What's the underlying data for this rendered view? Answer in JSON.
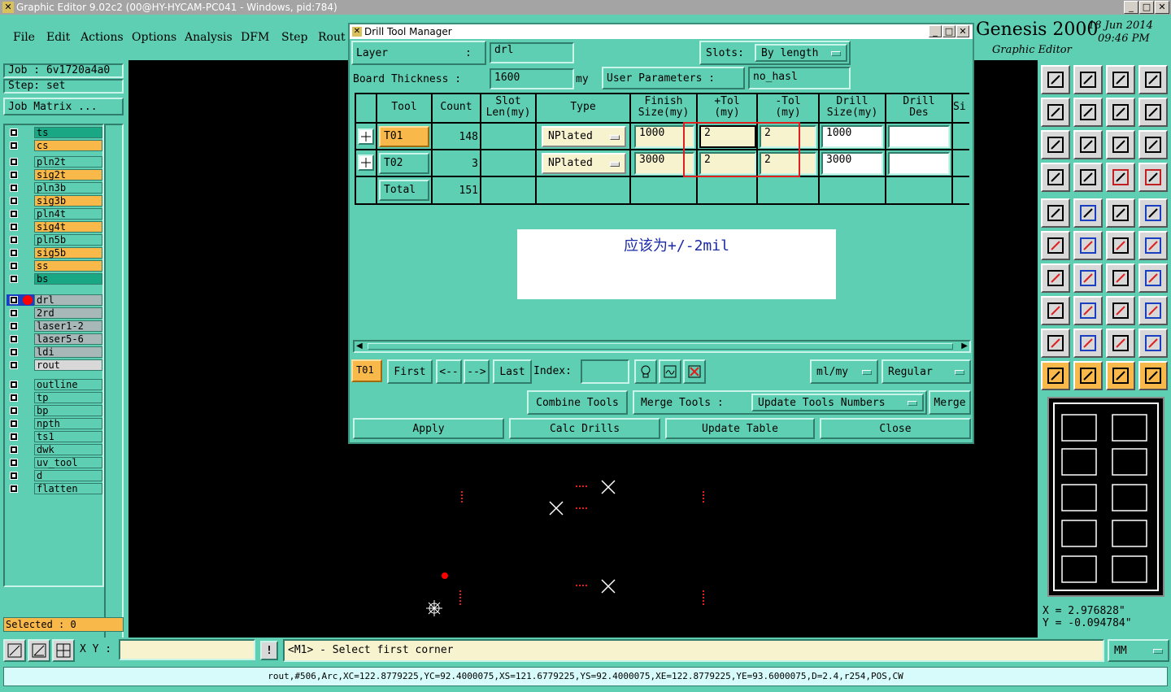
{
  "window": {
    "title": "Graphic Editor 9.02c2 (00@HY-HYCAM-PC041 - Windows, pid:784)"
  },
  "menu": {
    "items": [
      "File",
      "Edit",
      "Actions",
      "Options",
      "Analysis",
      "DFM",
      "Step",
      "Rout"
    ]
  },
  "brand": {
    "name": "Genesis 2000",
    "subtitle": "Graphic Editor",
    "date": "18 Jun 2014",
    "time": "09:46 PM"
  },
  "job": {
    "job_label": "Job : 6v1720a4a0",
    "step_label": "Step: set",
    "matrix_button": "Job Matrix ..."
  },
  "layers": [
    {
      "name": "ts",
      "color": "#1aa884"
    },
    {
      "name": "cs",
      "color": "#f8b84a"
    },
    {
      "name": "pln2t",
      "color": "#5fcfb3"
    },
    {
      "name": "sig2t",
      "color": "#f8b84a"
    },
    {
      "name": "pln3b",
      "color": "#5fcfb3"
    },
    {
      "name": "sig3b",
      "color": "#f8b84a"
    },
    {
      "name": "pln4t",
      "color": "#5fcfb3"
    },
    {
      "name": "sig4t",
      "color": "#f8b84a"
    },
    {
      "name": "pln5b",
      "color": "#5fcfb3"
    },
    {
      "name": "sig5b",
      "color": "#f8b84a"
    },
    {
      "name": "ss",
      "color": "#f8b84a"
    },
    {
      "name": "bs",
      "color": "#1aa884"
    },
    {
      "name": "drl",
      "color": "#a8b8b8"
    },
    {
      "name": "2rd",
      "color": "#a8b8b8"
    },
    {
      "name": "laser1-2",
      "color": "#a8b8b8"
    },
    {
      "name": "laser5-6",
      "color": "#a8b8b8"
    },
    {
      "name": "ldi",
      "color": "#a8b8b8"
    },
    {
      "name": "rout",
      "color": "#d8d8d8"
    },
    {
      "name": "outline",
      "color": "#5fcfb3"
    },
    {
      "name": "tp",
      "color": "#5fcfb3"
    },
    {
      "name": "bp",
      "color": "#5fcfb3"
    },
    {
      "name": "npth",
      "color": "#5fcfb3"
    },
    {
      "name": "ts1",
      "color": "#5fcfb3"
    },
    {
      "name": "dwk",
      "color": "#5fcfb3"
    },
    {
      "name": "uv_tool",
      "color": "#5fcfb3"
    },
    {
      "name": "d",
      "color": "#5fcfb3"
    },
    {
      "name": "flatten",
      "color": "#5fcfb3"
    }
  ],
  "selected": {
    "label": "Selected : 0"
  },
  "dialog": {
    "title": "Drill Tool Manager",
    "layer_label": "Layer",
    "layer_colon": ":",
    "layer_value": "drl",
    "slots_label": "Slots:",
    "slots_value": "By length",
    "board_thickness_label": "Board Thickness :",
    "board_thickness_value": "1600",
    "board_thickness_unit": "my",
    "user_params_button": "User Parameters :",
    "user_params_value": "no_hasl",
    "columns": [
      "Tool",
      "Count",
      "Slot Len(my)",
      "Type",
      "Finish Size(my)",
      "+Tol (my)",
      "-Tol (my)",
      "Drill Size(my)",
      "Drill Des",
      "Si"
    ],
    "rows": [
      {
        "tool": "T01",
        "count": "148",
        "type": "NPlated",
        "finish": "1000",
        "ptol": "2",
        "ntol": "2",
        "drill": "1000",
        "des": ""
      },
      {
        "tool": "T02",
        "count": "3",
        "type": "NPlated",
        "finish": "3000",
        "ptol": "2",
        "ntol": "2",
        "drill": "3000",
        "des": ""
      }
    ],
    "total": {
      "label": "Total",
      "count": "151"
    },
    "note": "应该为+/-2mil",
    "nav": {
      "current": "T01",
      "first": "First",
      "prev": "<--",
      "next": "-->",
      "last": "Last",
      "index_label": "Index:",
      "index_value": "",
      "units": "ml/my",
      "mode": "Regular"
    },
    "actions": {
      "combine": "Combine Tools",
      "merge_label": "Merge Tools :",
      "update_numbers": "Update Tools Numbers",
      "merge": "Merge"
    },
    "footer": {
      "apply": "Apply",
      "calc": "Calc Drills",
      "update": "Update Table",
      "close": "Close"
    }
  },
  "status": {
    "xy_label": "X Y :",
    "xy_value": "",
    "message": "<M1> - Select first corner",
    "units": "MM"
  },
  "coords": {
    "x": "X = 2.976828\"",
    "y": "Y = -0.094784\""
  },
  "info": {
    "text": "rout,#506,Arc,XC=122.8779225,YC=92.4000075,XS=121.6779225,YS=92.4000075,XE=122.8779225,YE=93.6000075,D=2.4,r254,POS,CW"
  }
}
